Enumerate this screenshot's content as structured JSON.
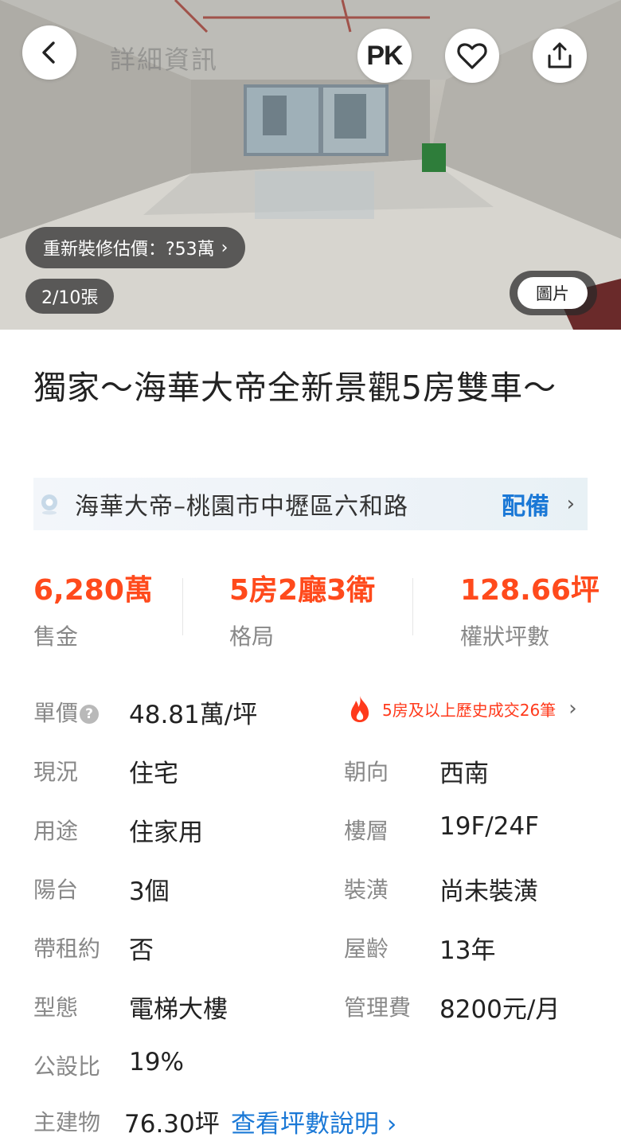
{
  "header": {
    "title": "詳細資訊",
    "pk_label": "PK"
  },
  "photo": {
    "renovation_estimate": "重新裝修估價：?53萬",
    "counter": "2/10張",
    "media_tab": "圖片"
  },
  "listing": {
    "title": "獨家～海華大帝全新景觀5房雙車～",
    "location": "海華大帝–桃園市中壢區六和路",
    "facility_link": "配備"
  },
  "stats": [
    {
      "value": "6,280萬",
      "label": "售金"
    },
    {
      "value": "5房2廳3衛",
      "label": "格局"
    },
    {
      "value": "128.66坪",
      "label": "權狀坪數"
    }
  ],
  "unit_price": {
    "label": "單價",
    "value": "48.81萬/坪",
    "history_link": "5房及以上歷史成交26筆"
  },
  "details_left": [
    {
      "label": "現況",
      "value": "住宅"
    },
    {
      "label": "用途",
      "value": "住家用"
    },
    {
      "label": "陽台",
      "value": "3個"
    },
    {
      "label": "帶租約",
      "value": "否"
    },
    {
      "label": "型態",
      "value": "電梯大樓"
    },
    {
      "label": "公設比",
      "value": "19%"
    }
  ],
  "details_right": [
    {
      "label": "朝向",
      "value": "西南"
    },
    {
      "label": "樓層",
      "value": "19F/24F"
    },
    {
      "label": "裝潢",
      "value": "尚未裝潢"
    },
    {
      "label": "屋齡",
      "value": "13年"
    },
    {
      "label": "管理費",
      "value": "8200元/月"
    }
  ],
  "main_building": {
    "label": "主建物",
    "value": "76.30坪",
    "link": "查看坪數說明"
  },
  "colors": {
    "accent_price": "#ff4a1c",
    "link_blue": "#1a78d6",
    "label_gray": "#888888"
  },
  "icons": [
    "back-icon",
    "heart-icon",
    "share-icon",
    "location-pin-icon",
    "help-icon",
    "fire-icon",
    "chevron-right-icon"
  ]
}
